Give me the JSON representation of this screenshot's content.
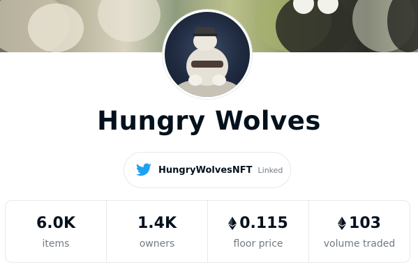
{
  "collection": {
    "name": "Hungry Wolves",
    "banner_icon": "collection-banner-image",
    "avatar_icon": "wolf-avatar-image"
  },
  "social": {
    "icon": "twitter-icon",
    "handle": "HungryWolvesNFT",
    "status": "Linked",
    "twitter_color": "#1da1f2"
  },
  "stats": [
    {
      "value": "6.0K",
      "label": "items",
      "eth": false
    },
    {
      "value": "1.4K",
      "label": "owners",
      "eth": false
    },
    {
      "value": "0.115",
      "label": "floor price",
      "eth": true
    },
    {
      "value": "103",
      "label": "volume traded",
      "eth": true
    }
  ],
  "colors": {
    "text_primary": "#04111d",
    "text_secondary": "#707a83",
    "border": "#e5e8eb"
  }
}
